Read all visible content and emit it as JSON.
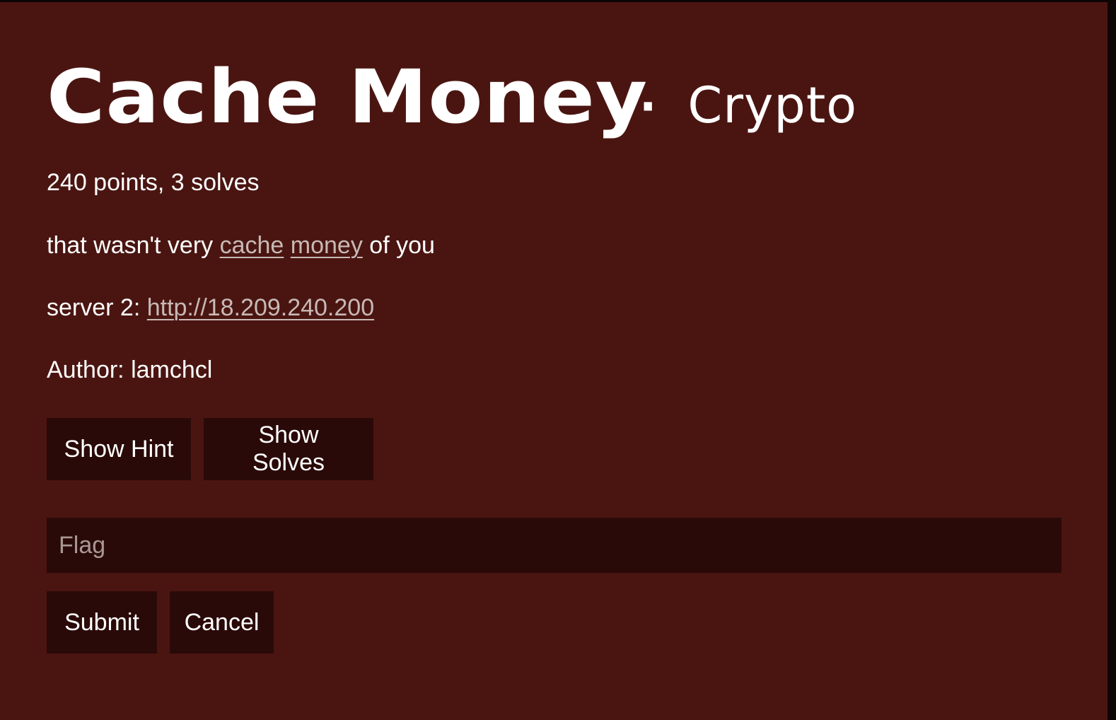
{
  "challenge": {
    "title": "Cache Money",
    "separator": "·",
    "category": "Crypto",
    "stats": "240 points, 3 solves",
    "description": {
      "prefix": "that wasn't very ",
      "link1": "cache",
      "space": " ",
      "link2": "money",
      "suffix": " of you"
    },
    "server": {
      "label": "server 2: ",
      "url": "http://18.209.240.200"
    },
    "author": "Author: lamchcl"
  },
  "buttons": {
    "show_hint": "Show Hint",
    "show_solves": "Show Solves",
    "submit": "Submit",
    "cancel": "Cancel"
  },
  "flag_input": {
    "placeholder": "Flag",
    "value": ""
  },
  "colors": {
    "background": "#4a1511",
    "button": "#2a0a08",
    "link": "#c8b9b6"
  }
}
